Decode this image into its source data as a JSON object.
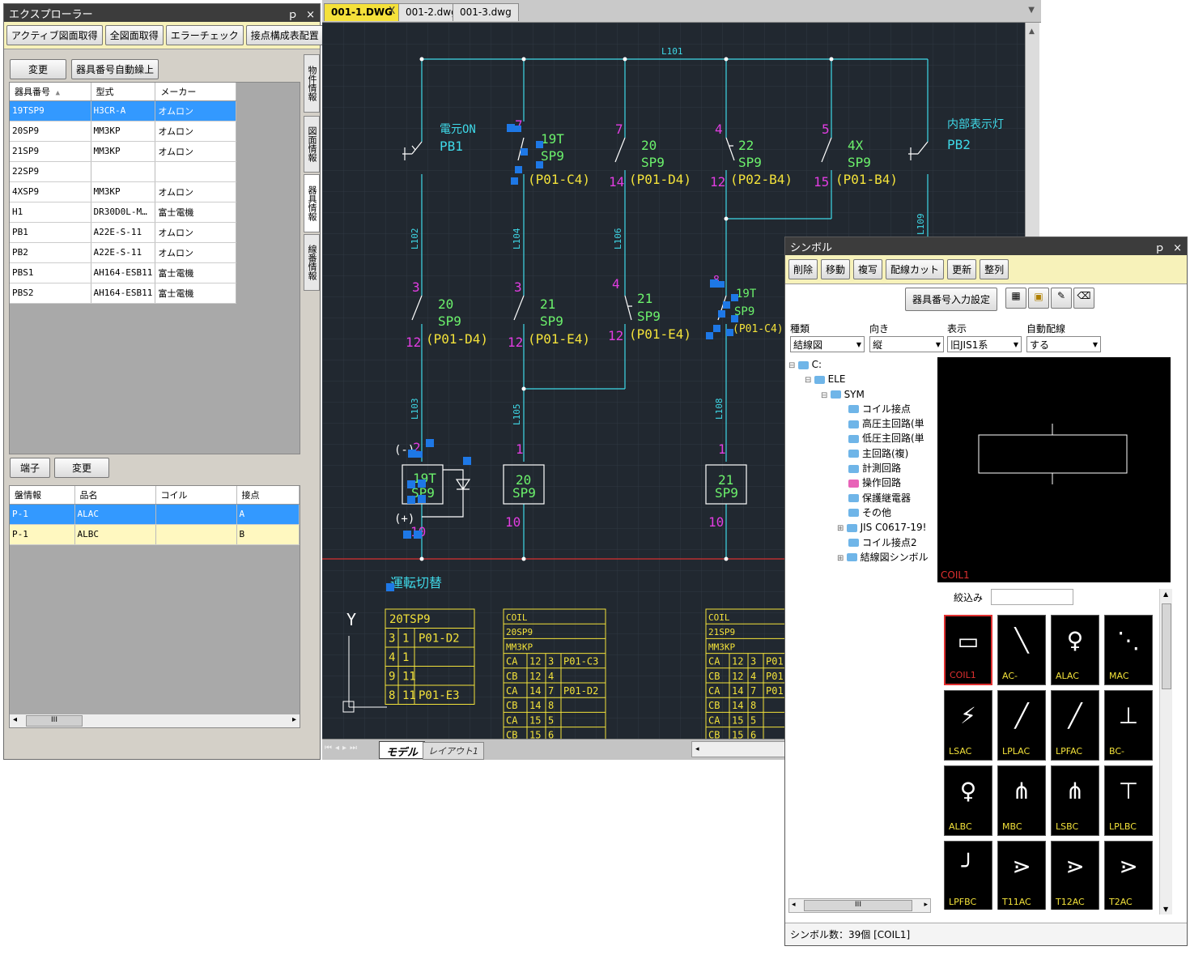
{
  "explorer": {
    "title": "エクスプローラー",
    "pin": "ｐ",
    "close": "×",
    "toolbar": [
      "アクティブ図面取得",
      "全図面取得",
      "エラーチェック",
      "接点構成表配置"
    ],
    "btn_change": "変更",
    "btn_auto": "器具番号自動繰上",
    "columns": [
      "器具番号",
      "型式",
      "メーカー"
    ],
    "rows": [
      [
        "19TSP9",
        "H3CR-A",
        "オムロン"
      ],
      [
        "20SP9",
        "MM3KP",
        "オムロン"
      ],
      [
        "21SP9",
        "MM3KP",
        "オムロン"
      ],
      [
        "22SP9",
        "",
        ""
      ],
      [
        "4XSP9",
        "MM3KP",
        "オムロン"
      ],
      [
        "H1",
        "DR30D0L-M…",
        "富士電機"
      ],
      [
        "PB1",
        "A22E-S-11",
        "オムロン"
      ],
      [
        "PB2",
        "A22E-S-11",
        "オムロン"
      ],
      [
        "PBS1",
        "AH164-ESB11",
        "富士電機"
      ],
      [
        "PBS2",
        "AH164-ESB11",
        "富士電機"
      ]
    ],
    "vtabs": [
      "物件情報",
      "図面情報",
      "器具情報",
      "線番情報"
    ],
    "btn_terminal": "端子",
    "btn_change2": "変更",
    "columns2": [
      "盤情報",
      "品名",
      "コイル",
      "接点"
    ],
    "rows2": [
      [
        "P-1",
        "ALAC",
        "",
        "A"
      ],
      [
        "P-1",
        "ALBC",
        "",
        "B"
      ]
    ],
    "hscroll_thumb": "III"
  },
  "doc": {
    "tabs": [
      "001-1.DWG",
      "001-2.dwg",
      "001-3.dwg"
    ],
    "tab_close": "X",
    "layout_tabs": [
      "モデル",
      "レイアウト1"
    ]
  },
  "drawing": {
    "wire_main": "L101",
    "wires": [
      "L102",
      "L104",
      "L106",
      "L103",
      "L105",
      "L108",
      "L109"
    ],
    "pb1_label": "電元ON",
    "pb1_name": "PB1",
    "pb2_label": "内部表示灯",
    "pb2_name": "PB2",
    "c1": {
      "top": "7",
      "no": "19T",
      "name": "SP9",
      "ref": "(P01-C4)"
    },
    "c2": {
      "top": "7",
      "no": "20",
      "name": "SP9",
      "ref": "(P01-D4)",
      "bot": "14"
    },
    "c3": {
      "top": "4",
      "no": "22",
      "name": "SP9",
      "ref": "(P02-B4)",
      "bot": "12"
    },
    "c4": {
      "top": "5",
      "no": "4X",
      "name": "SP9",
      "ref": "(P01-B4)",
      "bot": "15"
    },
    "c5": {
      "top": "3",
      "no": "20",
      "name": "SP9",
      "ref": "(P01-D4)",
      "bot": "12"
    },
    "c6": {
      "top": "3",
      "no": "21",
      "name": "SP9",
      "ref": "(P01-E4)",
      "bot": "12"
    },
    "c7": {
      "top": "4",
      "no": "21",
      "name": "SP9",
      "ref": "(P01-E4)",
      "bot": "12"
    },
    "c8": {
      "top": "8",
      "no": "19T",
      "name": "SP9",
      "ref": "(P01-C4)"
    },
    "coil1": {
      "no": "19T",
      "name": "SP9",
      "minus": "(-)",
      "plus": "(+)",
      "top": "2",
      "bot": "10"
    },
    "coil2": {
      "no": "20",
      "name": "SP9",
      "top": "1",
      "bot": "10"
    },
    "coil3": {
      "no": "21",
      "name": "SP9",
      "top": "1",
      "bot": "10"
    },
    "switch_label": "運転切替",
    "axis_y": "Y",
    "table1": {
      "title": "20TSP9",
      "rows": [
        [
          "3",
          "1",
          "P01-D2"
        ],
        [
          "4",
          "1",
          ""
        ],
        [
          "9",
          "11",
          ""
        ],
        [
          "8",
          "11",
          "P01-E3"
        ]
      ]
    },
    "table2": {
      "head": [
        "COIL",
        "20SP9",
        "MM3KP"
      ],
      "rows": [
        [
          "CA",
          "12",
          "3",
          "P01-C3"
        ],
        [
          "CB",
          "12",
          "4",
          ""
        ],
        [
          "CA",
          "14",
          "7",
          "P01-D2"
        ],
        [
          "CB",
          "14",
          "8",
          ""
        ],
        [
          "CA",
          "15",
          "5",
          ""
        ],
        [
          "CB",
          "15",
          "6",
          ""
        ]
      ]
    },
    "table3": {
      "head": [
        "COIL",
        "21SP9",
        "MM3KP"
      ],
      "rows": [
        [
          "CA",
          "12",
          "3",
          "P01-"
        ],
        [
          "CB",
          "12",
          "4",
          "P01-"
        ],
        [
          "CA",
          "14",
          "7",
          "P01-"
        ],
        [
          "CB",
          "14",
          "8",
          ""
        ],
        [
          "CA",
          "15",
          "5",
          ""
        ],
        [
          "CB",
          "15",
          "6",
          ""
        ]
      ]
    }
  },
  "symbol": {
    "title": "シンボル",
    "toolbar": [
      "削除",
      "移動",
      "複写",
      "配線カット",
      "更新",
      "整列"
    ],
    "btn_setting": "器具番号入力設定",
    "labels": [
      "種類",
      "向き",
      "表示",
      "自動配線"
    ],
    "values": [
      "結線図",
      "縦",
      "旧JIS1系",
      "する"
    ],
    "tree": [
      {
        "t": "C:",
        "d": 0,
        "pm": "-"
      },
      {
        "t": "ELE",
        "d": 1,
        "pm": "-"
      },
      {
        "t": "SYM",
        "d": 2,
        "pm": "-"
      },
      {
        "t": "コイル接点",
        "d": 3
      },
      {
        "t": "高圧主回路(単",
        "d": 3
      },
      {
        "t": "低圧主回路(単",
        "d": 3
      },
      {
        "t": "主回路(複)",
        "d": 3
      },
      {
        "t": "計測回路",
        "d": 3
      },
      {
        "t": "操作回路",
        "d": 3,
        "pink": true
      },
      {
        "t": "保護継電器",
        "d": 3
      },
      {
        "t": "その他",
        "d": 3
      },
      {
        "t": "JIS C0617-19!",
        "d": 3,
        "pm": "+"
      },
      {
        "t": "コイル接点2",
        "d": 3
      },
      {
        "t": "結線図シンボル",
        "d": 3,
        "pm": "+"
      }
    ],
    "preview_label": "COIL1",
    "filter_label": "絞込み",
    "filter_value": "",
    "tiles": [
      "COIL1",
      "AC-",
      "ALAC",
      "MAC",
      "LSAC",
      "LPLAC",
      "LPFAC",
      "BC-",
      "ALBC",
      "MBC",
      "LSBC",
      "LPLBC",
      "LPFBC",
      "T11AC",
      "T12AC",
      "T2AC"
    ],
    "hscroll_thumb": "III",
    "status": "シンボル数：39個 [COIL1]"
  }
}
